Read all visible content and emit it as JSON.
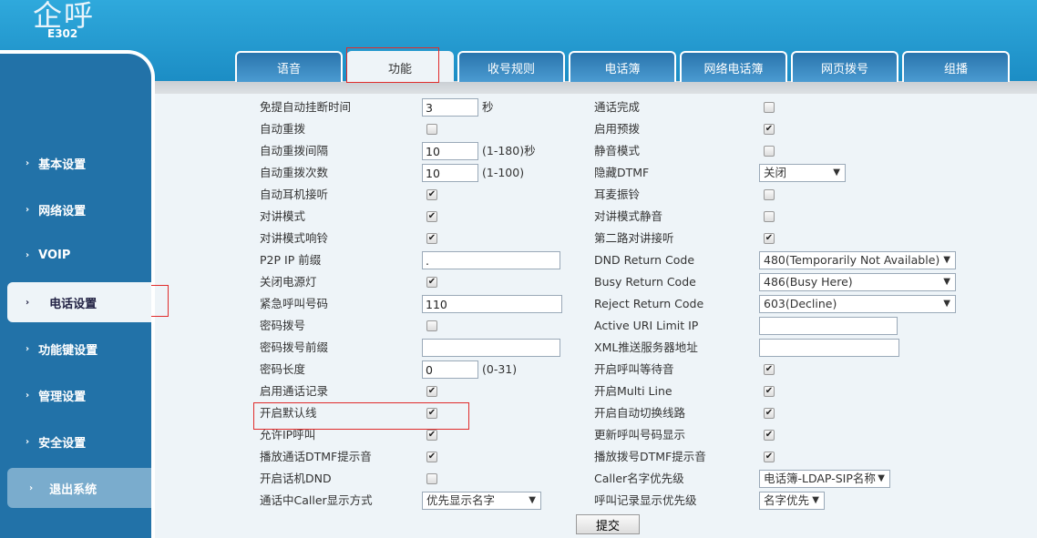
{
  "header": {
    "logo": "企呼",
    "model": "E302"
  },
  "tabs": [
    {
      "label": "语音"
    },
    {
      "label": "功能",
      "active": true
    },
    {
      "label": "收号规则"
    },
    {
      "label": "电话簿"
    },
    {
      "label": "网络电话簿"
    },
    {
      "label": "网页拨号"
    },
    {
      "label": "组播"
    }
  ],
  "sidebar": [
    {
      "label": "基本设置"
    },
    {
      "label": "网络设置"
    },
    {
      "label": "VOIP"
    },
    {
      "label": "电话设置",
      "active": true
    },
    {
      "label": "功能键设置"
    },
    {
      "label": "管理设置"
    },
    {
      "label": "安全设置"
    },
    {
      "label": "退出系统",
      "exit": true
    }
  ],
  "rows": [
    {
      "left": {
        "label": "免提自动挂断时间",
        "type": "input",
        "value": "3",
        "suffix": "秒"
      },
      "right": {
        "label": "通话完成",
        "type": "checkbox",
        "checked": false
      }
    },
    {
      "left": {
        "label": "自动重拨",
        "type": "checkbox",
        "checked": false
      },
      "right": {
        "label": "启用预拨",
        "type": "checkbox",
        "checked": true
      }
    },
    {
      "left": {
        "label": "自动重拨间隔",
        "type": "input",
        "value": "10",
        "suffix": "(1-180)秒"
      },
      "right": {
        "label": "静音模式",
        "type": "checkbox",
        "checked": false
      }
    },
    {
      "left": {
        "label": "自动重拨次数",
        "type": "input",
        "value": "10",
        "suffix": "(1-100)"
      },
      "right": {
        "label": "隐藏DTMF",
        "type": "select",
        "value": "关闭"
      }
    },
    {
      "left": {
        "label": "自动耳机接听",
        "type": "checkbox",
        "checked": true
      },
      "right": {
        "label": "耳麦振铃",
        "type": "checkbox",
        "checked": false
      }
    },
    {
      "left": {
        "label": "对讲模式",
        "type": "checkbox",
        "checked": true
      },
      "right": {
        "label": "对讲模式静音",
        "type": "checkbox",
        "checked": false
      }
    },
    {
      "left": {
        "label": "对讲模式响铃",
        "type": "checkbox",
        "checked": true
      },
      "right": {
        "label": "第二路对讲接听",
        "type": "checkbox",
        "checked": true
      }
    },
    {
      "left": {
        "label": "P2P IP 前缀",
        "type": "input",
        "value": "."
      },
      "right": {
        "label": "DND Return Code",
        "type": "select",
        "value": "480(Temporarily Not Available)"
      }
    },
    {
      "left": {
        "label": "关闭电源灯",
        "type": "checkbox",
        "checked": true
      },
      "right": {
        "label": "Busy Return Code",
        "type": "select",
        "value": "486(Busy Here)"
      }
    },
    {
      "left": {
        "label": "紧急呼叫号码",
        "type": "input",
        "value": "110"
      },
      "right": {
        "label": "Reject Return Code",
        "type": "select",
        "value": "603(Decline)"
      }
    },
    {
      "left": {
        "label": "密码拨号",
        "type": "checkbox",
        "checked": false
      },
      "right": {
        "label": "Active URI Limit IP",
        "type": "input",
        "value": ""
      }
    },
    {
      "left": {
        "label": "密码拨号前缀",
        "type": "input",
        "value": ""
      },
      "right": {
        "label": "XML推送服务器地址",
        "type": "input",
        "value": ""
      }
    },
    {
      "left": {
        "label": "密码长度",
        "type": "input",
        "value": "0",
        "suffix": "(0-31)"
      },
      "right": {
        "label": "开启呼叫等待音",
        "type": "checkbox",
        "checked": true
      }
    },
    {
      "left": {
        "label": "启用通话记录",
        "type": "checkbox",
        "checked": true
      },
      "right": {
        "label": "开启Multi Line",
        "type": "checkbox",
        "checked": true
      }
    },
    {
      "left": {
        "label": "开启默认线",
        "type": "checkbox",
        "checked": true
      },
      "right": {
        "label": "开启自动切换线路",
        "type": "checkbox",
        "checked": true
      }
    },
    {
      "left": {
        "label": "允许IP呼叫",
        "type": "checkbox",
        "checked": true
      },
      "right": {
        "label": "更新呼叫号码显示",
        "type": "checkbox",
        "checked": true
      }
    },
    {
      "left": {
        "label": "播放通话DTMF提示音",
        "type": "checkbox",
        "checked": true
      },
      "right": {
        "label": "播放拨号DTMF提示音",
        "type": "checkbox",
        "checked": true
      }
    },
    {
      "left": {
        "label": "开启话机DND",
        "type": "checkbox",
        "checked": false
      },
      "right": {
        "label": "Caller名字优先级",
        "type": "select",
        "value": "电话簿-LDAP-SIP名称"
      }
    },
    {
      "left": {
        "label": "通话中Caller显示方式",
        "type": "select",
        "value": "优先显示名字"
      },
      "right": {
        "label": "呼叫记录显示优先级",
        "type": "select",
        "value": "名字优先"
      }
    }
  ],
  "submit_label": "提交",
  "colors": {
    "header": "#1b8cc4",
    "sidebar": "#2272a8",
    "highlight": "#e02b2b"
  }
}
